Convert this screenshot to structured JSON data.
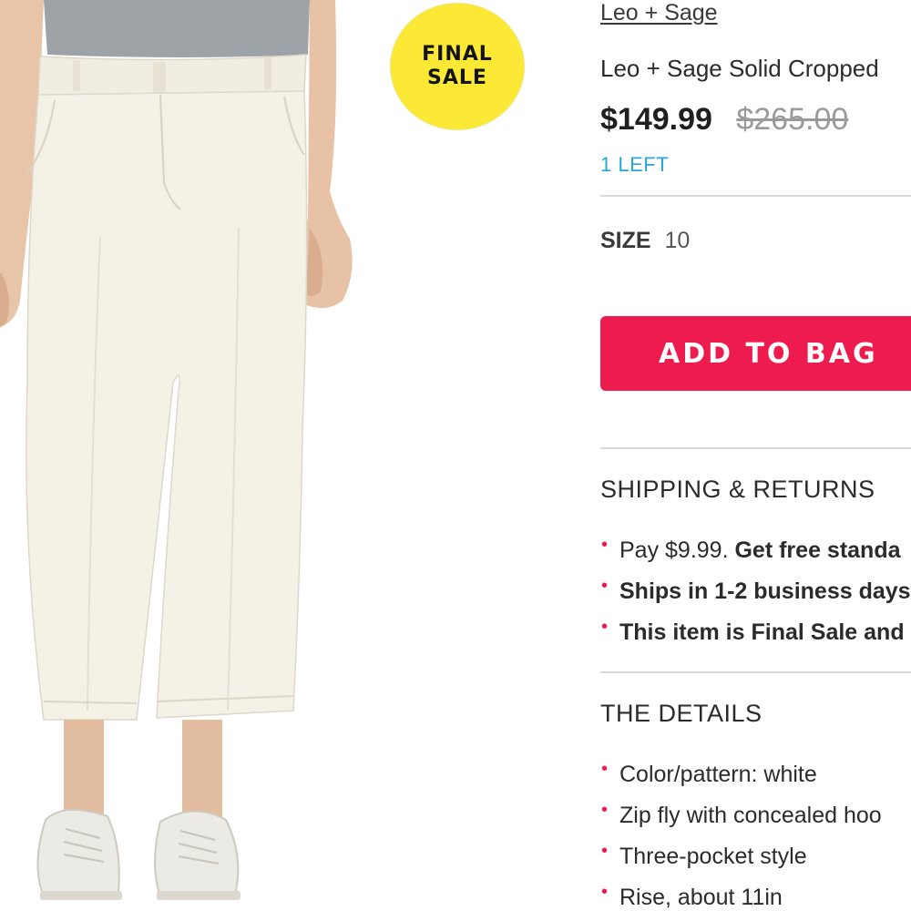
{
  "badge": {
    "line1": "FINAL",
    "line2": "SALE"
  },
  "product": {
    "brand": "Leo + Sage",
    "title": "Leo + Sage Solid Cropped",
    "sale_price": "$149.99",
    "original_price": "$265.00",
    "stock_note": "1 LEFT",
    "image_description": "white-cropped-pants"
  },
  "size": {
    "label": "SIZE",
    "value": "10"
  },
  "add_to_bag": {
    "label": "ADD TO BAG"
  },
  "shipping": {
    "heading": "SHIPPING & RETURNS",
    "items": [
      {
        "normal": "Pay $9.99. ",
        "bold": "Get free standa"
      },
      {
        "normal": "",
        "bold": "Ships in 1-2 business days"
      },
      {
        "normal": "",
        "bold": "This item is Final Sale and"
      }
    ]
  },
  "details": {
    "heading": "THE DETAILS",
    "items": [
      "Color/pattern: white",
      "Zip fly with concealed hoo",
      "Three-pocket style",
      "Rise, about 11in"
    ]
  },
  "colors": {
    "accent": "#ee1b4f",
    "stock": "#2aa7d9",
    "badge": "#fbe935"
  }
}
